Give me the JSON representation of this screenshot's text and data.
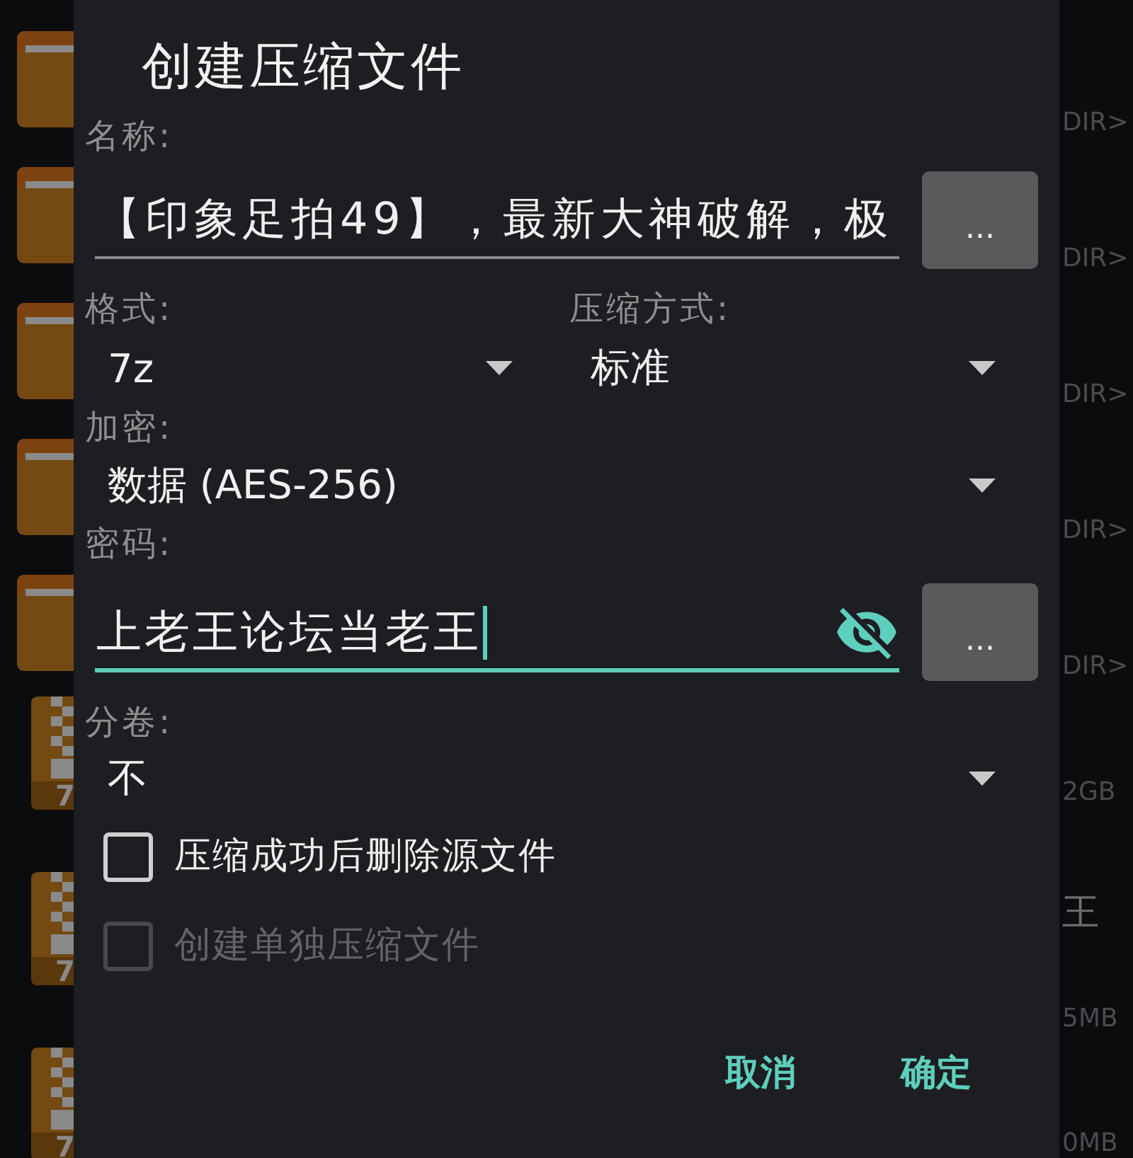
{
  "background_list": [
    {
      "kind": "folder",
      "size": "DIR>"
    },
    {
      "kind": "folder",
      "size": "DIR>"
    },
    {
      "kind": "folder",
      "size": "DIR>"
    },
    {
      "kind": "folder",
      "size": "DIR>"
    },
    {
      "kind": "folder",
      "size": "DIR>"
    },
    {
      "kind": "archive",
      "icon_label": "7",
      "size": "2GB"
    },
    {
      "kind": "archive",
      "icon_label": "7",
      "name": "王",
      "size": "5MB"
    },
    {
      "kind": "archive",
      "icon_label": "7",
      "size": "0MB"
    }
  ],
  "dialog": {
    "title": "创建压缩文件",
    "name": {
      "label": "名称:",
      "value": "【印象足拍49】，最新大神破解，极",
      "focused": false,
      "button": "..."
    },
    "format": {
      "label": "格式:",
      "value": "7z"
    },
    "compression": {
      "label": "压缩方式:",
      "value": "标准"
    },
    "encryption": {
      "label": "加密:",
      "value": "数据 (AES-256)"
    },
    "password": {
      "label": "密码:",
      "value": "上老王论坛当老王",
      "focused": true,
      "visible": true,
      "button": "..."
    },
    "split": {
      "label": "分卷:",
      "value": "不"
    },
    "checkboxes": [
      {
        "label": "压缩成功后删除源文件",
        "checked": false,
        "disabled": false
      },
      {
        "label": "创建单独压缩文件",
        "checked": false,
        "disabled": true
      }
    ],
    "buttons": [
      {
        "label": "取消"
      },
      {
        "label": "确定"
      }
    ]
  }
}
